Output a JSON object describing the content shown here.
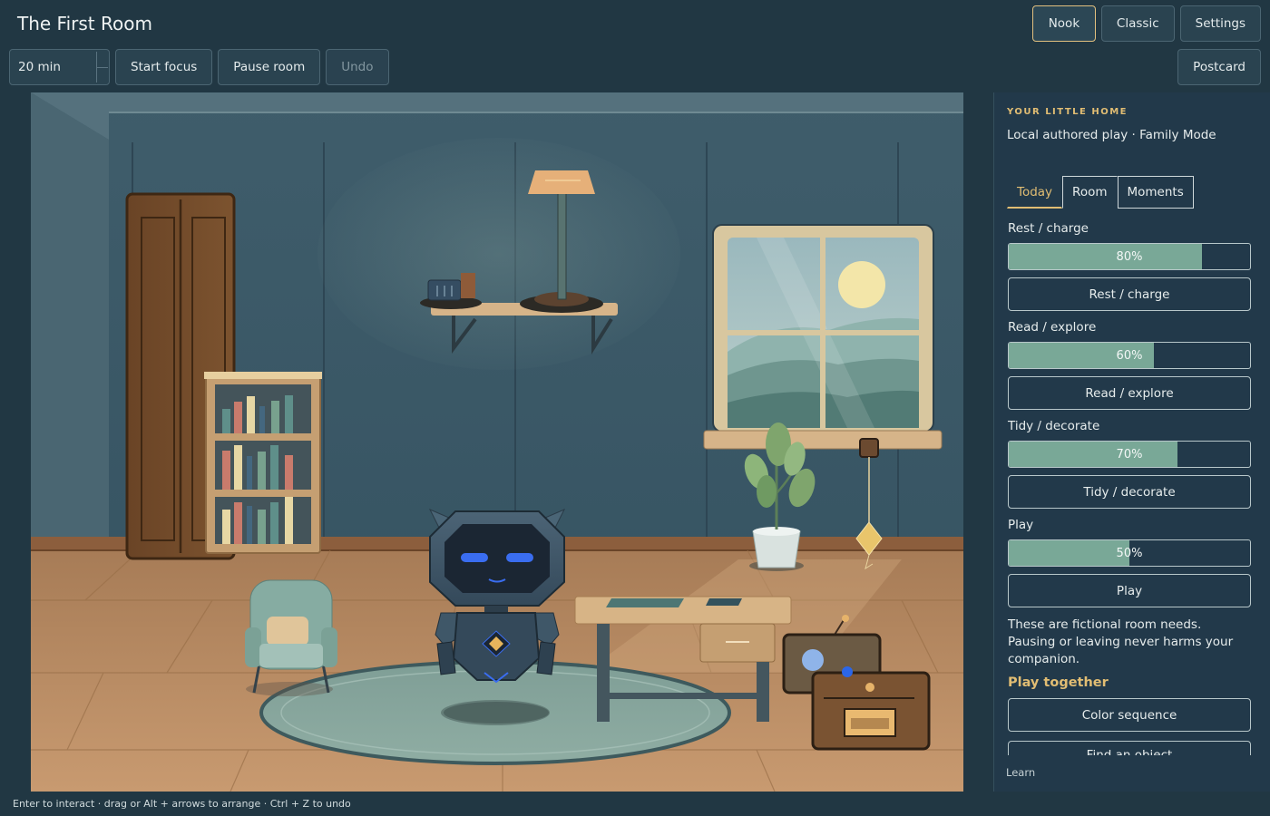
{
  "app": {
    "title": "The First Room"
  },
  "nav": {
    "nook": "Nook",
    "classic": "Classic",
    "settings": "Settings"
  },
  "toolbar": {
    "duration_value": "20 min",
    "start_focus": "Start focus",
    "pause_room": "Pause room",
    "undo": "Undo",
    "postcard": "Postcard"
  },
  "footer": {
    "hint": "Enter to interact · drag or Alt + arrows to arrange · Ctrl + Z to undo"
  },
  "panel": {
    "eyebrow": "YOUR LITTLE HOME",
    "subtitle": "Local authored play · Family Mode",
    "tabs": [
      {
        "label": "Today",
        "active": true
      },
      {
        "label": "Room",
        "active": false
      },
      {
        "label": "Moments",
        "active": false
      }
    ],
    "needs": [
      {
        "label": "Rest / charge",
        "value": 80,
        "value_text": "80%",
        "button": "Rest / charge"
      },
      {
        "label": "Read / explore",
        "value": 60,
        "value_text": "60%",
        "button": "Read / explore"
      },
      {
        "label": "Tidy / decorate",
        "value": 70,
        "value_text": "70%",
        "button": "Tidy / decorate"
      },
      {
        "label": "Play",
        "value": 50,
        "value_text": "50%",
        "button": "Play"
      }
    ],
    "note": "These are fictional room needs. Pausing or leaving never harms your companion.",
    "play_title": "Play together",
    "games": [
      "Color sequence",
      "Find an object"
    ],
    "learn": "Learn"
  },
  "colors": {
    "background": "#213743",
    "accent": "#e1bd73",
    "bar_fill": "#79a897",
    "wall": "#3b5866",
    "floor": "#b98a60"
  }
}
